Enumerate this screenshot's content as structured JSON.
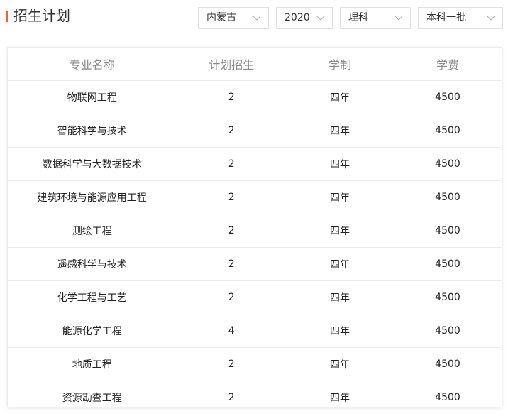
{
  "header": {
    "title": "招生计划"
  },
  "filters": {
    "province": "内蒙古",
    "year": "2020",
    "subject": "理科",
    "batch": "本科一批"
  },
  "icons": {
    "dropdown": "chevron-down-icon"
  },
  "colors": {
    "accent": "#f0642d"
  },
  "table": {
    "headers": {
      "major": "专业名称",
      "plan": "计划招生",
      "duration": "学制",
      "tuition": "学费"
    },
    "rows": [
      {
        "major": "物联网工程",
        "plan": "2",
        "duration": "四年",
        "tuition": "4500"
      },
      {
        "major": "智能科学与技术",
        "plan": "2",
        "duration": "四年",
        "tuition": "4500"
      },
      {
        "major": "数据科学与大数据技术",
        "plan": "2",
        "duration": "四年",
        "tuition": "4500"
      },
      {
        "major": "建筑环境与能源应用工程",
        "plan": "2",
        "duration": "四年",
        "tuition": "4500"
      },
      {
        "major": "测绘工程",
        "plan": "2",
        "duration": "四年",
        "tuition": "4500"
      },
      {
        "major": "遥感科学与技术",
        "plan": "2",
        "duration": "四年",
        "tuition": "4500"
      },
      {
        "major": "化学工程与工艺",
        "plan": "2",
        "duration": "四年",
        "tuition": "4500"
      },
      {
        "major": "能源化学工程",
        "plan": "4",
        "duration": "四年",
        "tuition": "4500"
      },
      {
        "major": "地质工程",
        "plan": "2",
        "duration": "四年",
        "tuition": "4500"
      },
      {
        "major": "资源勘查工程",
        "plan": "2",
        "duration": "四年",
        "tuition": "4500"
      }
    ]
  }
}
